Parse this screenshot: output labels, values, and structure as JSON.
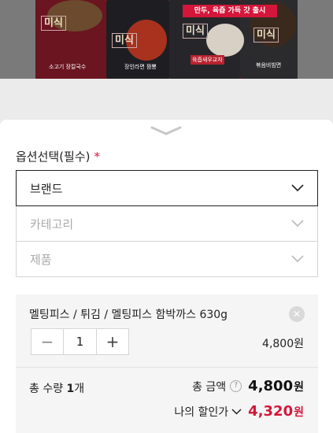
{
  "banner": {
    "brand_mark": "미식",
    "promo_text": "만두, 육즙 가득 갓 출시",
    "product_labels": [
      "소고기 장칼국수",
      "장인라면 짬뽕",
      "육즙새우교자",
      "볶음비빔면"
    ]
  },
  "options": {
    "title": "옵션선택(필수)",
    "required_mark": "*",
    "selects": [
      {
        "label": "브랜드",
        "state": "active"
      },
      {
        "label": "카테고리",
        "state": "disabled"
      },
      {
        "label": "제품",
        "state": "disabled"
      }
    ]
  },
  "selected_option": {
    "name": "멜팅피스 / 튀김 / 멜팅피스 함박까스 630g",
    "remove_icon": "close-icon",
    "quantity": "1",
    "minus": "−",
    "plus": "+",
    "price": "4,800원"
  },
  "summary": {
    "qty_prefix": "총 수량 ",
    "qty_value": "1",
    "qty_suffix": "개",
    "total_label": "총 금액",
    "help": "?",
    "total_amount": "4,800",
    "total_unit": "원",
    "discount_label": "나의 할인가",
    "discount_amount": "4,320",
    "discount_unit": "원"
  },
  "colors": {
    "accent": "#d4163a",
    "panel": "#f5f5f5",
    "border": "#d5d5d5"
  }
}
